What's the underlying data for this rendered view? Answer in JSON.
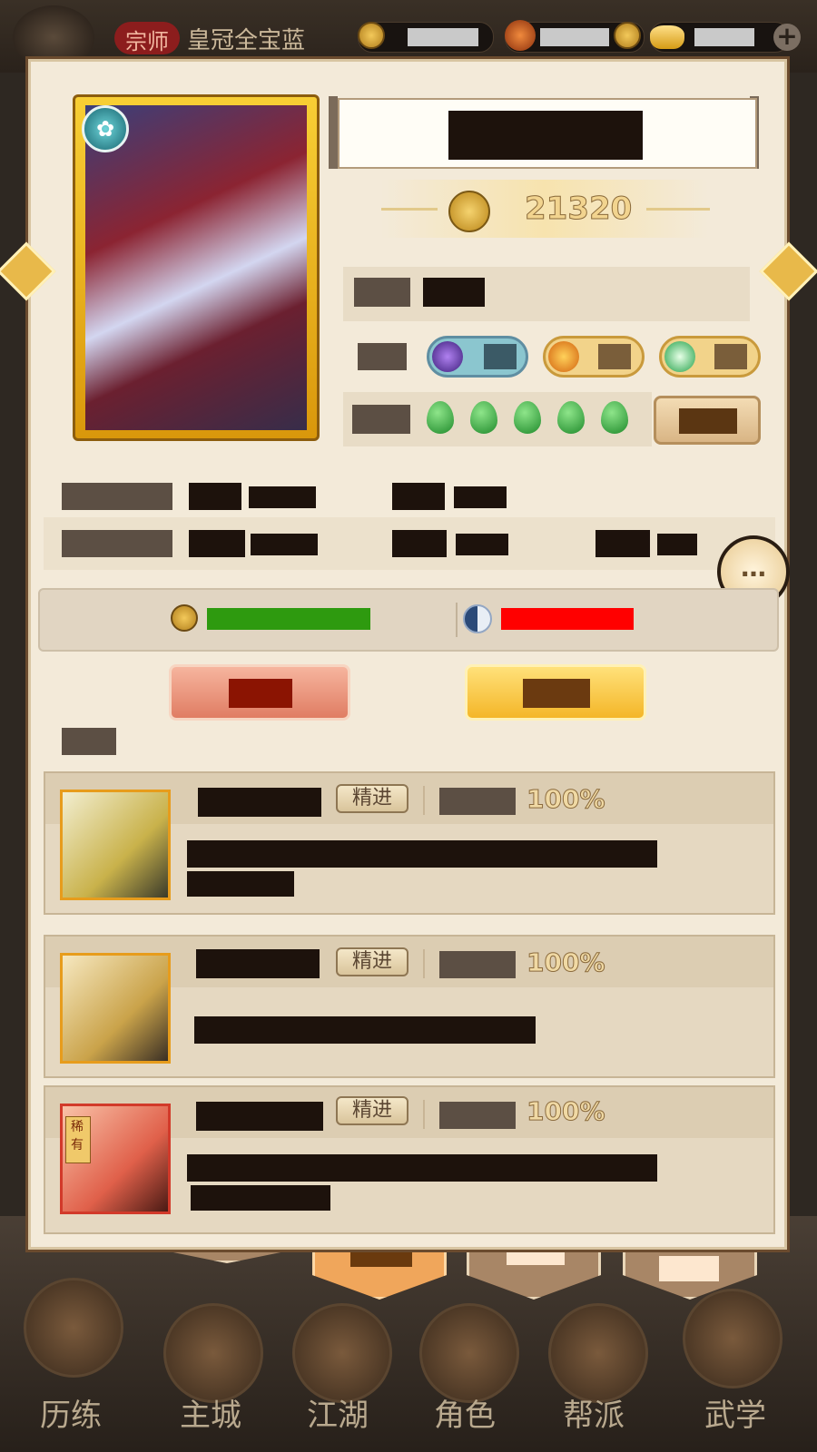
{
  "topbar": {
    "rank_label": "宗师",
    "title": "皇冠全宝蓝"
  },
  "hero": {
    "power": "21320"
  },
  "skills": [
    {
      "tag": "精进",
      "percent": "100%",
      "rarity_badge": ""
    },
    {
      "tag": "精进",
      "percent": "100%",
      "rarity_badge": ""
    },
    {
      "tag": "精进",
      "percent": "100%",
      "rarity_badge": "稀有"
    }
  ],
  "resources": {
    "coin_bar_color": "#2e9a0f",
    "yinyang_bar_color": "#ff0000"
  },
  "nav": {
    "items": [
      "历练",
      "主城",
      "江湖",
      "角色",
      "帮派",
      "武学"
    ]
  },
  "icons": {
    "coin": "coin-icon",
    "add": "plus-icon",
    "chat": "chat-bubble-icon",
    "yinyang": "yinyang-icon"
  }
}
